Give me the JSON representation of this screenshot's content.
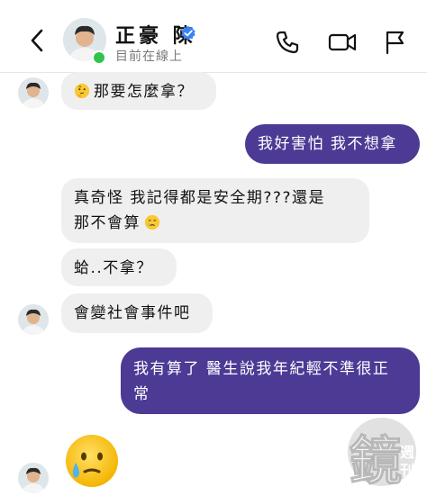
{
  "header": {
    "contact_name": "正豪 陳",
    "status": "目前在線上",
    "icons": {
      "back": "chevron-left-icon",
      "call": "phone-icon",
      "video": "video-camera-icon",
      "report": "flag-icon",
      "verified": "verified-badge-icon"
    },
    "colors": {
      "verified": "#3b82f6",
      "online": "#31c44d"
    }
  },
  "messages": [
    {
      "from": "them",
      "text": "那要怎麼拿？",
      "emoji": "thinking-face"
    },
    {
      "from": "me",
      "text": "我好害怕 我不想拿"
    },
    {
      "from": "them",
      "line1": "真奇怪 我記得都是安全期???還是",
      "line2": "那不會算",
      "emoji_after": "crying-face"
    },
    {
      "from": "them",
      "text": "蛤..不拿？"
    },
    {
      "from": "them",
      "text": "會變社會事件吧"
    },
    {
      "from": "me",
      "line1": "我有算了 醫生說我年紀輕不準很正",
      "line2": "常"
    },
    {
      "from": "them",
      "emoji": "sad-but-relieved-face"
    }
  ],
  "colors": {
    "outgoing_bubble": "#4c3a95",
    "incoming_bubble": "#efefef"
  },
  "watermark": {
    "big": "鏡",
    "small1": "週",
    "small2": "刊"
  }
}
